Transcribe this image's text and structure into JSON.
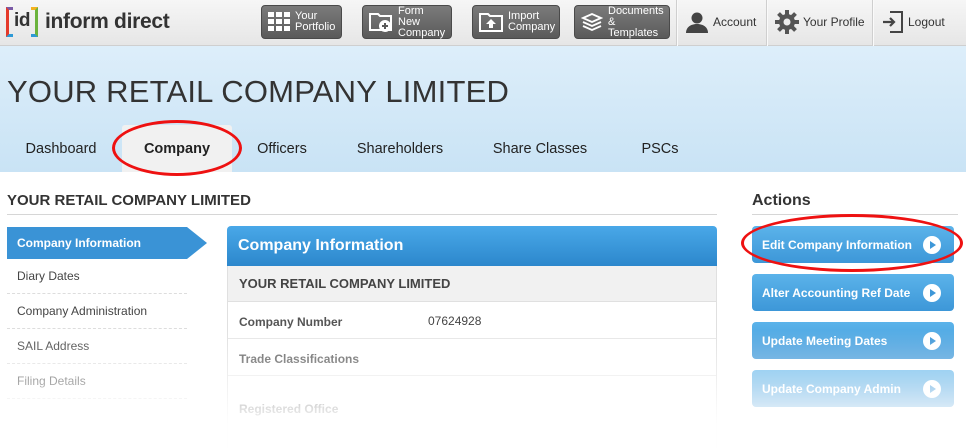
{
  "topbar": {
    "logo_mark": "id",
    "logo_text": "inform direct",
    "buttons": [
      {
        "label": "Your\nPortfolio",
        "icon": "grid-icon"
      },
      {
        "label": "Form New\nCompany",
        "icon": "folder-plus-icon"
      },
      {
        "label": "Import\nCompany",
        "icon": "upload-icon"
      },
      {
        "label": "Documents\n& Templates",
        "icon": "documents-stack-icon"
      }
    ],
    "links": [
      {
        "label": "Account",
        "icon": "user-icon"
      },
      {
        "label": "Your Profile",
        "icon": "gear-icon"
      },
      {
        "label": "Logout",
        "icon": "logout-icon"
      }
    ]
  },
  "page_title": "YOUR RETAIL COMPANY LIMITED",
  "tabs": [
    {
      "label": "Dashboard",
      "active": false
    },
    {
      "label": "Company",
      "active": true
    },
    {
      "label": "Officers",
      "active": false
    },
    {
      "label": "Shareholders",
      "active": false
    },
    {
      "label": "Share Classes",
      "active": false
    },
    {
      "label": "PSCs",
      "active": false
    }
  ],
  "section_title": "YOUR RETAIL COMPANY LIMITED",
  "sidebar": {
    "items": [
      {
        "label": "Company Information",
        "active": true
      },
      {
        "label": "Diary Dates",
        "active": false
      },
      {
        "label": "Company Administration",
        "active": false
      },
      {
        "label": "SAIL Address",
        "active": false
      },
      {
        "label": "Filing Details",
        "active": false
      }
    ]
  },
  "panel": {
    "header": "Company Information",
    "subheader": "YOUR RETAIL COMPANY LIMITED",
    "fields": [
      {
        "label": "Company Number",
        "value": "07624928"
      },
      {
        "label": "Trade Classifications",
        "value": ""
      },
      {
        "label": "Registered Office",
        "value": ""
      }
    ]
  },
  "actions": {
    "title": "Actions",
    "buttons": [
      {
        "label": "Edit Company Information"
      },
      {
        "label": "Alter Accounting Ref Date"
      },
      {
        "label": "Update Meeting Dates"
      },
      {
        "label": "Update Company Admin"
      }
    ]
  },
  "colors": {
    "accent_blue": "#3a93d6",
    "highlight_red": "#e11111",
    "band_light_blue": "#d4e9f8",
    "toolbar_button_grey": "#6a6a6a"
  }
}
